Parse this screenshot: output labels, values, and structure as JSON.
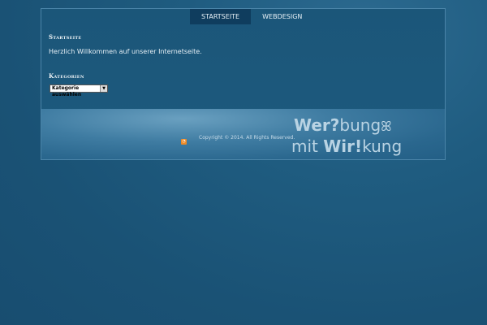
{
  "nav": {
    "items": [
      {
        "label": "STARTSEITE",
        "active": true
      },
      {
        "label": "WEBDESIGN",
        "active": false
      }
    ]
  },
  "content": {
    "title": "Startseite",
    "text": "Herzlich Willkommen auf unserer Internetseite."
  },
  "sidebar": {
    "categories_title": "Kategorien",
    "select_value": "Kategorie auswählen"
  },
  "footer": {
    "copyright": "Copyright © 2014. All Rights Reserved.",
    "rss_icon": "rss-icon",
    "logo": {
      "w1a": "Wer?",
      "w1b": "bung",
      "w2a": "mit ",
      "w2b": "Wir!",
      "w2c": "kung"
    }
  },
  "colors": {
    "background": "#1d5a7e",
    "active_tab": "#0f3d5e"
  }
}
